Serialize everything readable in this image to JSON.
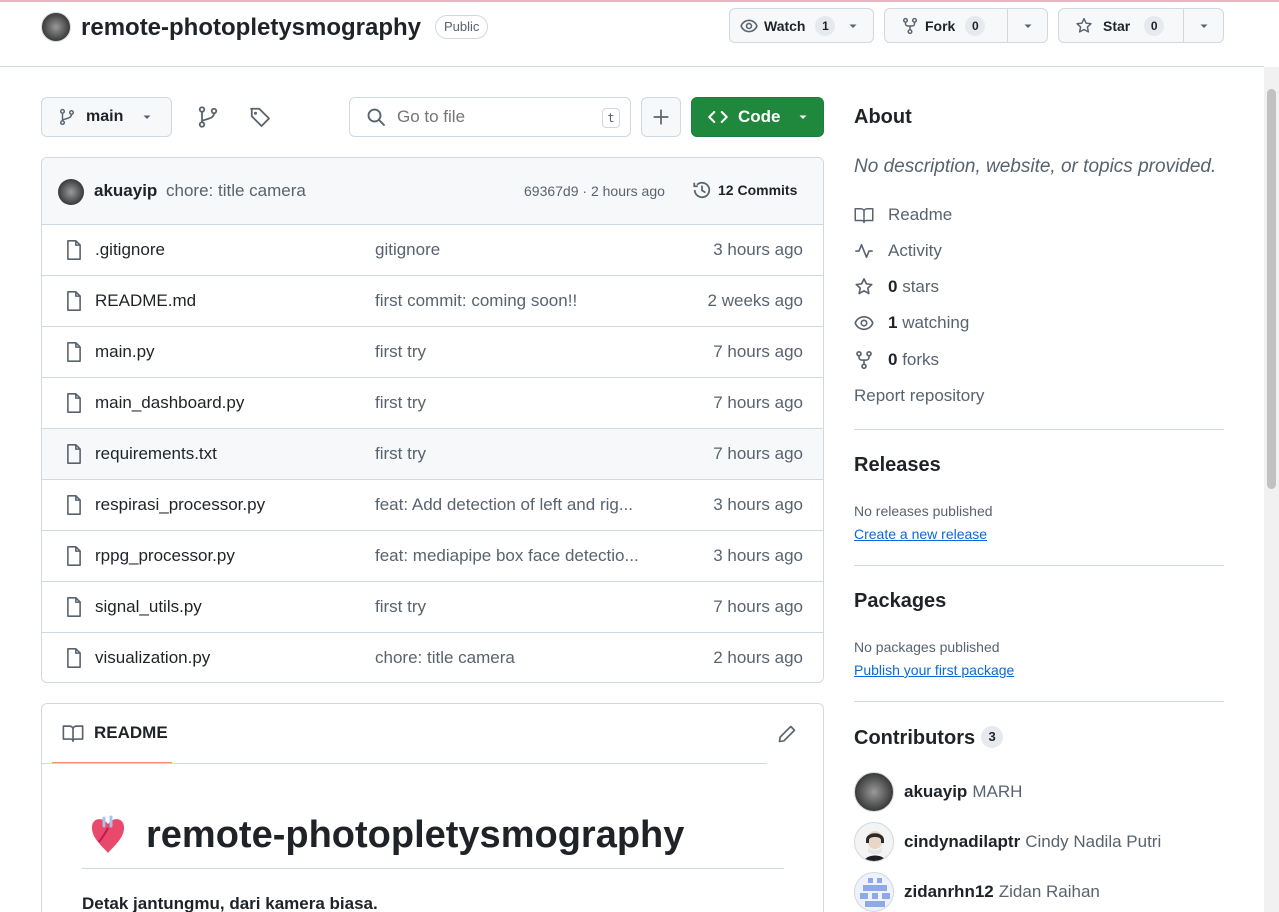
{
  "repo": {
    "name": "remote-photopletysmography",
    "visibility": "Public",
    "watch": {
      "label": "Watch",
      "count": "1"
    },
    "fork": {
      "label": "Fork",
      "count": "0"
    },
    "star": {
      "label": "Star",
      "count": "0"
    }
  },
  "toolbar": {
    "branch": "main",
    "search_placeholder": "Go to file",
    "search_shortcut": "t",
    "code_label": "Code"
  },
  "latest_commit": {
    "author": "akuayip",
    "message": "chore: title camera",
    "sha_time": "69367d9 · 2 hours ago",
    "commits_label": "12 Commits"
  },
  "files": [
    {
      "name": ".gitignore",
      "message": "gitignore",
      "time": "3 hours ago"
    },
    {
      "name": "README.md",
      "message": "first commit: coming soon!!",
      "time": "2 weeks ago"
    },
    {
      "name": "main.py",
      "message": "first try",
      "time": "7 hours ago"
    },
    {
      "name": "main_dashboard.py",
      "message": "first try",
      "time": "7 hours ago"
    },
    {
      "name": "requirements.txt",
      "message": "first try",
      "time": "7 hours ago"
    },
    {
      "name": "respirasi_processor.py",
      "message": "feat: Add detection of left and rig...",
      "time": "3 hours ago"
    },
    {
      "name": "rppg_processor.py",
      "message": "feat: mediapipe box face detectio...",
      "time": "3 hours ago"
    },
    {
      "name": "signal_utils.py",
      "message": "first try",
      "time": "7 hours ago"
    },
    {
      "name": "visualization.py",
      "message": "chore: title camera",
      "time": "2 hours ago"
    }
  ],
  "readme": {
    "tab_label": "README",
    "title": "remote-photopletysmography",
    "subtitle": "Detak jantungmu, dari kamera biasa."
  },
  "about": {
    "heading": "About",
    "description": "No description, website, or topics provided.",
    "readme": "Readme",
    "activity": "Activity",
    "stars_count": "0",
    "stars_label": "stars",
    "watching_count": "1",
    "watching_label": "watching",
    "forks_count": "0",
    "forks_label": "forks",
    "report": "Report repository"
  },
  "releases": {
    "heading": "Releases",
    "empty": "No releases published",
    "link": "Create a new release"
  },
  "packages": {
    "heading": "Packages",
    "empty": "No packages published",
    "link": "Publish your first package"
  },
  "contributors": {
    "heading": "Contributors",
    "count": "3",
    "list": [
      {
        "login": "akuayip",
        "name": "MARH"
      },
      {
        "login": "cindynadilaptr",
        "name": "Cindy Nadila Putri"
      },
      {
        "login": "zidanrhn12",
        "name": "Zidan Raihan"
      }
    ]
  },
  "colors": {
    "accent_green": "#1f883d",
    "link_blue": "#0969da",
    "tab_underline": "#fd8c73"
  }
}
